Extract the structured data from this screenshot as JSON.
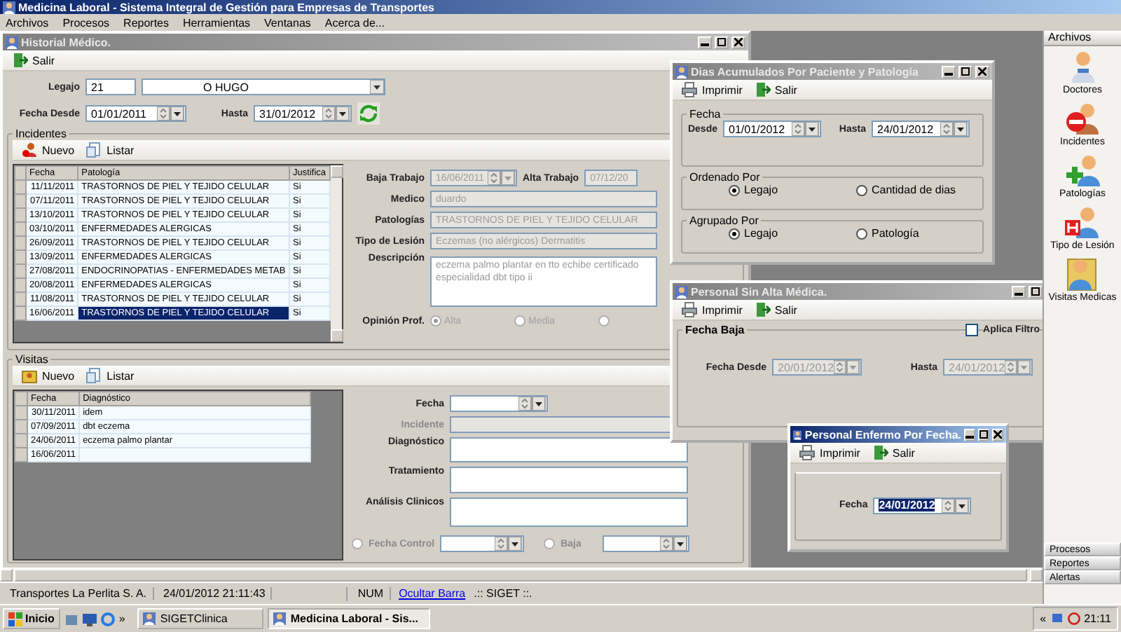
{
  "app": {
    "title": "Medicina Laboral - Sistema Integral de Gestión para Empresas de Transportes"
  },
  "menu": [
    "Archivos",
    "Procesos",
    "Reportes",
    "Herramientas",
    "Ventanas",
    "Acerca de..."
  ],
  "historial": {
    "title": "Historial Médico.",
    "active": false,
    "toolbar": [
      {
        "label": "Salir",
        "kind": "exit"
      }
    ],
    "legajo": {
      "label": "Legajo",
      "code": "21",
      "name": "O HUGO"
    },
    "fecha_desde": {
      "label": "Fecha Desde",
      "value": "01/01/2011"
    },
    "hasta": {
      "label": "Hasta",
      "value": "31/01/2012"
    },
    "incidentes": {
      "title": "Incidentes",
      "toolbar": [
        {
          "label": "Nuevo",
          "kind": "new"
        },
        {
          "label": "Listar",
          "kind": "list"
        }
      ],
      "columns": [
        "Fecha",
        "Patología",
        "Justifica"
      ],
      "rows": [
        {
          "cells": [
            "11/11/2011",
            "TRASTORNOS DE PIEL Y TEJIDO CELULAR",
            "Si"
          ],
          "selected": false
        },
        {
          "cells": [
            "07/11/2011",
            "TRASTORNOS DE PIEL Y TEJIDO CELULAR",
            "Si"
          ],
          "selected": false
        },
        {
          "cells": [
            "13/10/2011",
            "TRASTORNOS DE PIEL Y TEJIDO CELULAR",
            "Si"
          ],
          "selected": false
        },
        {
          "cells": [
            "03/10/2011",
            "ENFERMEDADES ALERGICAS",
            "Si"
          ],
          "selected": false
        },
        {
          "cells": [
            "26/09/2011",
            "TRASTORNOS DE PIEL Y TEJIDO CELULAR",
            "Si"
          ],
          "selected": false
        },
        {
          "cells": [
            "13/09/2011",
            "ENFERMEDADES ALERGICAS",
            "Si"
          ],
          "selected": false
        },
        {
          "cells": [
            "27/08/2011",
            "ENDOCRINOPATIAS - ENFERMEDADES METAB",
            "Si"
          ],
          "selected": false
        },
        {
          "cells": [
            "20/08/2011",
            "ENFERMEDADES ALERGICAS",
            "Si"
          ],
          "selected": false
        },
        {
          "cells": [
            "11/08/2011",
            "TRASTORNOS DE PIEL Y TEJIDO CELULAR",
            "Si"
          ],
          "selected": false
        },
        {
          "cells": [
            "16/06/2011",
            "TRASTORNOS DE PIEL Y TEJIDO CELULAR",
            "Si"
          ],
          "selected": true
        }
      ],
      "disabled": true,
      "baja_trabajo": {
        "label": "Baja Trabajo",
        "value": "16/06/2011"
      },
      "alta_trabajo": {
        "label": "Alta Trabajo",
        "value": "07/12/20"
      },
      "medico": {
        "label": "Medico",
        "value": "duardo"
      },
      "patologias": {
        "label": "Patologías",
        "value": "TRASTORNOS DE PIEL Y TEJIDO CELULAR"
      },
      "tipo_lesion": {
        "label": "Tipo de Lesión",
        "value": "Eczemas (no alérgicos) Dermatitis"
      },
      "descripcion": {
        "label": "Descripción",
        "value": "eczema  palmo plantar en tto echibe certificado especialidad dbt tipo ii"
      },
      "opinion": {
        "label": "Opinión Prof.",
        "options": [
          {
            "label": "Alta",
            "selected": true
          },
          {
            "label": "Media",
            "selected": false
          },
          {
            "selected": false
          }
        ]
      }
    },
    "visitas": {
      "title": "Visitas",
      "toolbar": [
        {
          "label": "Nuevo",
          "kind": "new-visit"
        },
        {
          "label": "Listar",
          "kind": "list"
        }
      ],
      "columns": [
        "Fecha",
        "Diagnóstico"
      ],
      "rows": [
        {
          "cells": [
            "30/11/2011",
            "idem"
          ]
        },
        {
          "cells": [
            "07/09/2011",
            "dbt eczema"
          ]
        },
        {
          "cells": [
            "24/06/2011",
            "eczema palmo plantar"
          ]
        },
        {
          "cells": [
            "16/06/2011",
            ""
          ]
        }
      ],
      "fecha": {
        "label": "Fecha"
      },
      "incidente": {
        "label": "Incidente",
        "disabled": true
      },
      "diagnostico": {
        "label": "Diagnóstico"
      },
      "tratamiento": {
        "label": "Tratamiento"
      },
      "analisis": {
        "label": "Análisis Clinicos"
      },
      "fecha_control": {
        "label": "Fecha Control",
        "selected": false
      },
      "baja": {
        "label": "Baja",
        "selected": false
      }
    }
  },
  "dias": {
    "title": "Dias Acumulados Por Paciente y Patología",
    "active": false,
    "toolbar": [
      {
        "label": "Imprimir",
        "kind": "print"
      },
      {
        "label": "Salir",
        "kind": "exit"
      }
    ],
    "fecha": {
      "title": "Fecha",
      "desde": {
        "label": "Desde",
        "value": "01/01/2012"
      },
      "hasta": {
        "label": "Hasta",
        "value": "24/01/2012"
      }
    },
    "ordenado": {
      "title": "Ordenado Por",
      "options": [
        {
          "label": "Legajo",
          "selected": true
        },
        {
          "label": "Cantidad de dias",
          "selected": false
        }
      ]
    },
    "agrupado": {
      "title": "Agrupado Por",
      "options": [
        {
          "label": "Legajo",
          "selected": true
        },
        {
          "label": "Patología",
          "selected": false
        }
      ]
    }
  },
  "sin_alta": {
    "title": "Personal Sin Alta Médica.",
    "active": false,
    "toolbar": [
      {
        "label": "Imprimir",
        "kind": "print"
      },
      {
        "label": "Salir",
        "kind": "exit"
      }
    ],
    "group": "Fecha Baja",
    "filter": {
      "label": "Aplica Filtro",
      "checked": false
    },
    "desde": {
      "label": "Fecha Desde",
      "value": "20/01/2012",
      "disabled": true
    },
    "hasta": {
      "label": "Hasta",
      "value": "24/01/2012",
      "disabled": true
    }
  },
  "enfermo": {
    "title": "Personal Enfermo Por Fecha.",
    "active": true,
    "toolbar": [
      {
        "label": "Imprimir",
        "kind": "print"
      },
      {
        "label": "Salir",
        "kind": "exit"
      }
    ],
    "fecha": {
      "label": "Fecha",
      "value": "24/01/2012",
      "selected": true
    }
  },
  "sidebar": {
    "header": "Archivos",
    "items": [
      {
        "label": "Doctores",
        "kind": "doctor"
      },
      {
        "label": "Incidentes",
        "kind": "incident"
      },
      {
        "label": "Patologías",
        "kind": "pathology"
      },
      {
        "label": "Tipo de Lesión",
        "kind": "injury"
      },
      {
        "label": "Visitas Medicas",
        "kind": "visit"
      }
    ],
    "footer": [
      "Procesos",
      "Reportes",
      "Alertas"
    ]
  },
  "status": {
    "company": "Transportes La Perlita S. A.",
    "datetime": "24/01/2012 21:11:43",
    "num": "NUM",
    "link": "Ocultar Barra",
    "brand": ".:: SIGET ::."
  },
  "taskbar": {
    "start": "Inicio",
    "more": "»",
    "tasks": [
      {
        "label": "SIGETClinica",
        "selected": false
      },
      {
        "label": "Medicina Laboral - Sis...",
        "selected": true
      }
    ],
    "tray_toggle": "«",
    "clock": "21:11"
  }
}
